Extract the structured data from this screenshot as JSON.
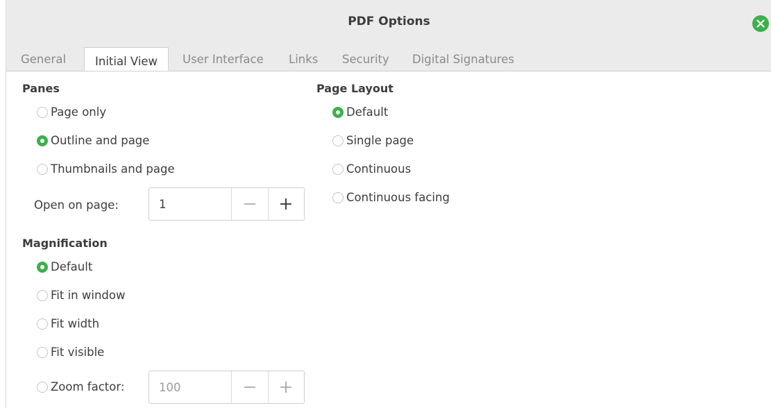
{
  "window": {
    "title": "PDF Options"
  },
  "tabs": [
    {
      "label": "General"
    },
    {
      "label": "Initial View"
    },
    {
      "label": "User Interface"
    },
    {
      "label": "Links"
    },
    {
      "label": "Security"
    },
    {
      "label": "Digital Signatures"
    }
  ],
  "active_tab": "Initial View",
  "panes": {
    "title": "Panes",
    "options": [
      "Page only",
      "Outline and page",
      "Thumbnails and page"
    ],
    "selected": "Outline and page",
    "open_on_page": {
      "label": "Open on page:",
      "value": "1"
    }
  },
  "magnification": {
    "title": "Magnification",
    "options": [
      "Default",
      "Fit in window",
      "Fit width",
      "Fit visible",
      "Zoom factor:"
    ],
    "selected": "Default",
    "zoom_factor": {
      "value": "100",
      "enabled": false
    }
  },
  "page_layout": {
    "title": "Page Layout",
    "options": [
      "Default",
      "Single page",
      "Continuous",
      "Continuous facing"
    ],
    "selected": "Default"
  },
  "colors": {
    "accent": "#3bb14a",
    "titlebar": "#ebebeb",
    "text": "#3c3c3c",
    "muted_text": "#8a8a8a"
  },
  "icons": {
    "close": "close-icon",
    "minus": "minus-icon",
    "plus": "plus-icon"
  }
}
